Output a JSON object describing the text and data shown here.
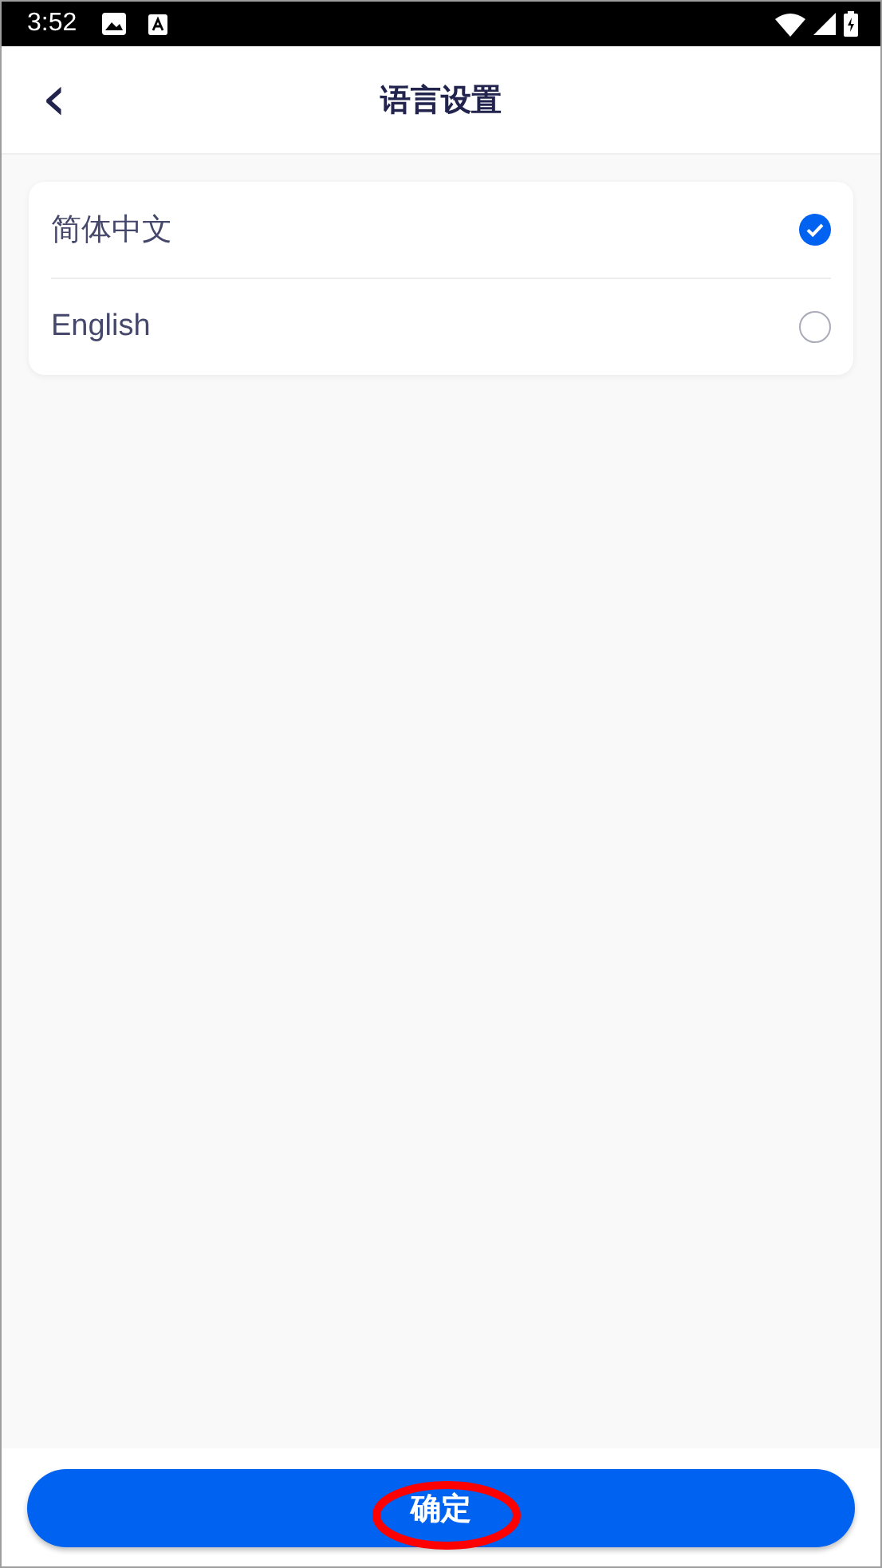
{
  "status_bar": {
    "time": "3:52"
  },
  "header": {
    "back": "‹",
    "title": "语言设置"
  },
  "languages": [
    {
      "label": "简体中文",
      "selected": true
    },
    {
      "label": "English",
      "selected": false
    }
  ],
  "confirm_button": {
    "label": "确定"
  }
}
